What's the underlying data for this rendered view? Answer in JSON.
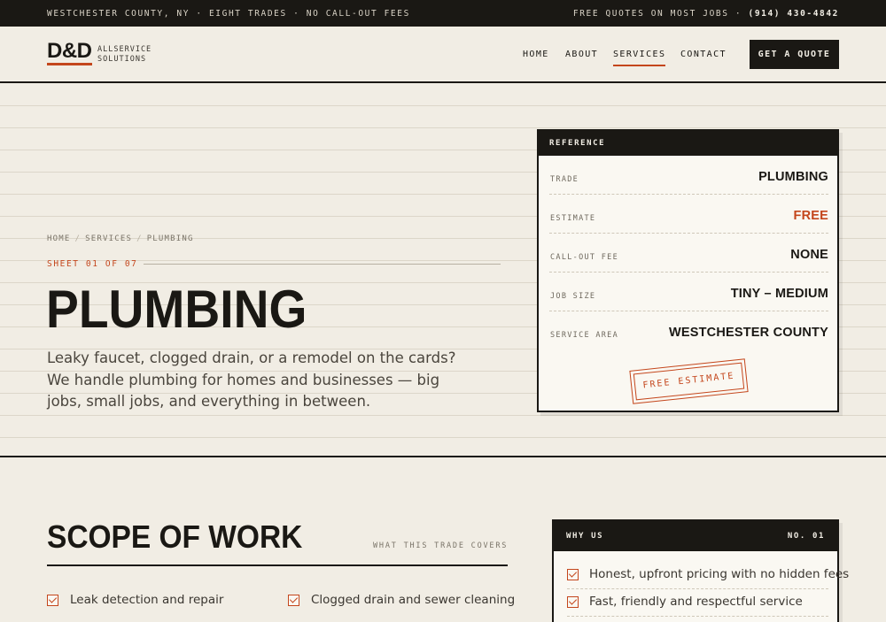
{
  "topbar": {
    "left": "WESTCHESTER COUNTY, NY · EIGHT TRADES · NO CALL-OUT FEES",
    "right_prefix": "FREE QUOTES ON MOST JOBS ·",
    "phone": "(914) 430-4842"
  },
  "brand": {
    "mark": "D&D",
    "line1": "ALLSERVICE",
    "line2": "SOLUTIONS"
  },
  "nav": {
    "items": [
      "HOME",
      "ABOUT",
      "SERVICES",
      "CONTACT"
    ],
    "active": "SERVICES",
    "cta": "GET A QUOTE"
  },
  "hero": {
    "breadcrumb": [
      "HOME",
      "SERVICES",
      "PLUMBING"
    ],
    "sheet": "SHEET 01 OF 07",
    "title": "PLUMBING",
    "lede": "Leaky faucet, clogged drain, or a remodel on the cards? We handle plumbing for homes and businesses — big jobs, small jobs, and everything in between."
  },
  "reference": {
    "heading": "REFERENCE",
    "rows": [
      {
        "key": "TRADE",
        "value": "PLUMBING"
      },
      {
        "key": "ESTIMATE",
        "value": "FREE"
      },
      {
        "key": "CALL-OUT FEE",
        "value": "NONE"
      },
      {
        "key": "JOB SIZE",
        "value": "TINY – MEDIUM"
      },
      {
        "key": "SERVICE AREA",
        "value": "WESTCHESTER COUNTY"
      }
    ],
    "stamp": "FREE ESTIMATE"
  },
  "scope": {
    "title": "SCOPE OF WORK",
    "kicker": "WHAT THIS TRADE COVERS",
    "items": [
      "Leak detection and repair",
      "Clogged drain and sewer cleaning"
    ]
  },
  "why": {
    "heading": "WHY US",
    "number": "NO. 01",
    "items": [
      "Honest, upfront pricing with no hidden fees",
      "Fast, friendly and respectful service"
    ]
  },
  "colors": {
    "ink": "#1a1814",
    "paper": "#f1ede4",
    "card": "#faf8f2",
    "accent": "#c4461c"
  }
}
